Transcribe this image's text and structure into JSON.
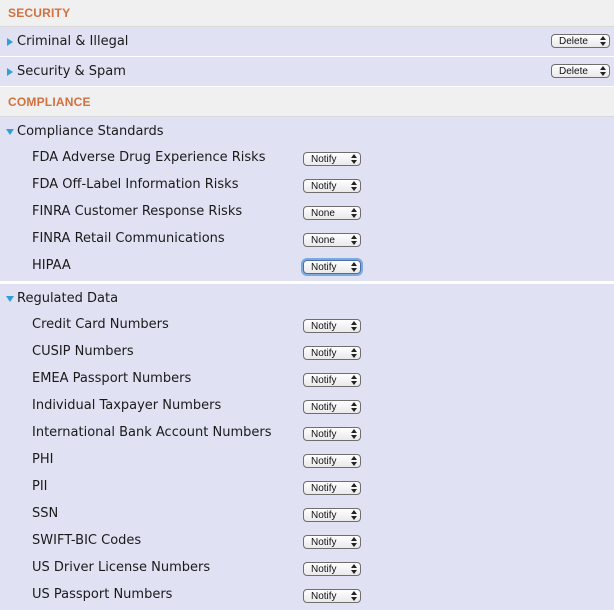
{
  "security": {
    "title": "SECURITY",
    "rows": [
      {
        "label": "Criminal & Illegal",
        "action": "Delete"
      },
      {
        "label": "Security & Spam",
        "action": "Delete"
      }
    ]
  },
  "compliance": {
    "title": "COMPLIANCE",
    "groups": [
      {
        "title": "Compliance Standards",
        "items": [
          {
            "label": "FDA Adverse Drug Experience Risks",
            "value": "Notify"
          },
          {
            "label": "FDA Off-Label Information Risks",
            "value": "Notify"
          },
          {
            "label": "FINRA Customer Response Risks",
            "value": "None"
          },
          {
            "label": "FINRA Retail Communications",
            "value": "None"
          },
          {
            "label": "HIPAA",
            "value": "Notify"
          }
        ]
      },
      {
        "title": "Regulated Data",
        "items": [
          {
            "label": "Credit Card Numbers",
            "value": "Notify"
          },
          {
            "label": "CUSIP Numbers",
            "value": "Notify"
          },
          {
            "label": "EMEA Passport Numbers",
            "value": "Notify"
          },
          {
            "label": "Individual Taxpayer Numbers",
            "value": "Notify"
          },
          {
            "label": "International Bank Account Numbers",
            "value": "Notify"
          },
          {
            "label": "PHI",
            "value": "Notify"
          },
          {
            "label": "PII",
            "value": "Notify"
          },
          {
            "label": "SSN",
            "value": "Notify"
          },
          {
            "label": "SWIFT-BIC Codes",
            "value": "Notify"
          },
          {
            "label": "US Driver License Numbers",
            "value": "Notify"
          },
          {
            "label": "US Passport Numbers",
            "value": "Notify"
          }
        ]
      }
    ]
  },
  "icons": {
    "collapsed": "triangle-right-icon",
    "expanded": "triangle-down-icon",
    "select_arrows": "updown-arrows-icon"
  },
  "colors": {
    "section_title": "#d2703f",
    "row_bg": "#e0e2f4",
    "section_bg": "#f0f0f0",
    "triangle": "#2f9fd6",
    "focus_ring": "#7ea9de"
  }
}
